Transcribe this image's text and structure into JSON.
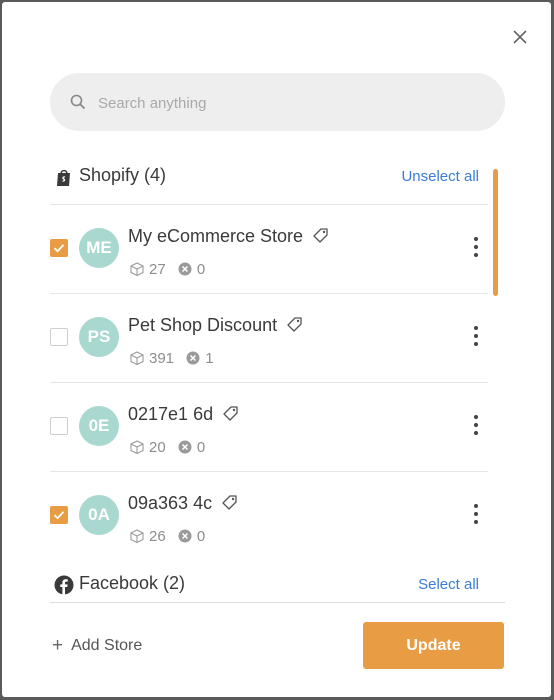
{
  "modal": {
    "close_icon": "close-icon"
  },
  "search": {
    "placeholder": "Search anything",
    "icon": "search-icon"
  },
  "groups": {
    "shopify": {
      "icon": "shopify-bag-icon",
      "title": "Shopify (4)",
      "action": "Unselect all"
    },
    "facebook": {
      "icon": "facebook-icon",
      "title": "Facebook (2)",
      "action": "Select all"
    }
  },
  "stores": [
    {
      "initials": "ME",
      "name": "My eCommerce Store",
      "checked": true,
      "products": "27",
      "errors": "0"
    },
    {
      "initials": "PS",
      "name": "Pet Shop Discount",
      "checked": false,
      "products": "391",
      "errors": "1"
    },
    {
      "initials": "0E",
      "name": "0217e1 6d",
      "checked": false,
      "products": "20",
      "errors": "0"
    },
    {
      "initials": "0A",
      "name": "09a363 4c",
      "checked": true,
      "products": "26",
      "errors": "0"
    }
  ],
  "footer": {
    "add_store_label": "Add Store",
    "update_label": "Update"
  },
  "colors": {
    "accent": "#e89c43",
    "avatar": "#a8d8cf",
    "link": "#3a7bd5"
  }
}
